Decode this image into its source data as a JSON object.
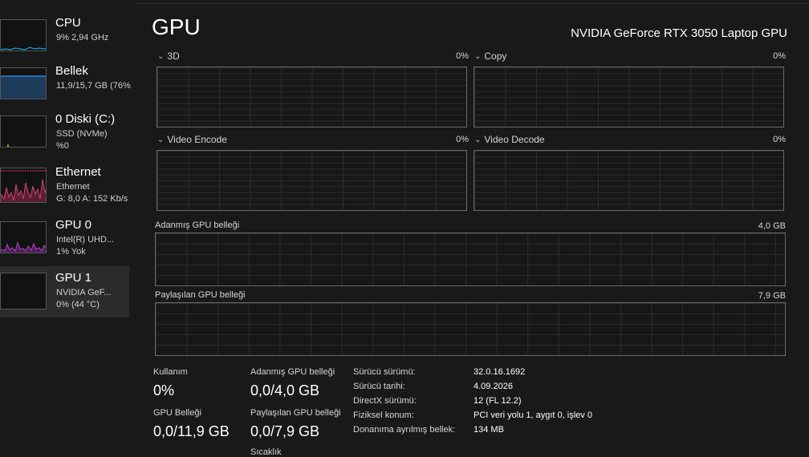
{
  "sidebar": {
    "items": [
      {
        "title": "CPU",
        "sub1": "9% 2,94 GHz",
        "sub2": ""
      },
      {
        "title": "Bellek",
        "sub1": "11,9/15,7 GB (76%",
        "sub2": ""
      },
      {
        "title": "0 Diski (C:)",
        "sub1": "SSD (NVMe)",
        "sub2": "%0"
      },
      {
        "title": "Ethernet",
        "sub1": "Ethernet",
        "sub2": "G: 8,0 A: 152 Kb/s"
      },
      {
        "title": "GPU 0",
        "sub1": "Intel(R) UHD...",
        "sub2": "1% Yok"
      },
      {
        "title": "GPU 1",
        "sub1": "NVIDIA GeF...",
        "sub2": "0% (44 °C)"
      }
    ]
  },
  "header": {
    "title": "GPU",
    "model": "NVIDIA GeForce RTX 3050 Laptop GPU"
  },
  "graphs": {
    "g3d": {
      "label": "3D",
      "value": "0%"
    },
    "copy": {
      "label": "Copy",
      "value": "0%"
    },
    "encode": {
      "label": "Video Encode",
      "value": "0%"
    },
    "decode": {
      "label": "Video Decode",
      "value": "0%"
    },
    "dedicated": {
      "label": "Adanmış GPU belleği",
      "value": "4,0 GB"
    },
    "shared": {
      "label": "Paylaşılan GPU belleği",
      "value": "7,9 GB"
    }
  },
  "stats": {
    "usage": {
      "label": "Kullanım",
      "value": "0%"
    },
    "gpu_memory": {
      "label": "GPU Belleği",
      "value": "0,0/11,9 GB"
    },
    "dedicated": {
      "label": "Adanmış GPU belleği",
      "value": "0,0/4,0 GB"
    },
    "shared": {
      "label": "Paylaşılan GPU belleği",
      "value": "0,0/7,9 GB"
    },
    "temperature": {
      "label": "Sıcaklık"
    }
  },
  "info": [
    {
      "key": "Sürücü sürümü:",
      "value": "32.0.16.1692"
    },
    {
      "key": "Sürücü tarihi:",
      "value": "4.09.2026"
    },
    {
      "key": "DirectX sürümü:",
      "value": "12 (FL 12.2)"
    },
    {
      "key": "Fiziksel konum:",
      "value": "PCI veri yolu 1, aygıt 0, işlev 0"
    },
    {
      "key": "Donanıma ayrılmış bellek:",
      "value": "134 MB"
    }
  ],
  "colors": {
    "cpu": "#17a2d8",
    "memory": "#2f7fd0",
    "disk": "#7fbf2a",
    "ethernet": "#d0456e",
    "gpu": "#b540c8"
  }
}
